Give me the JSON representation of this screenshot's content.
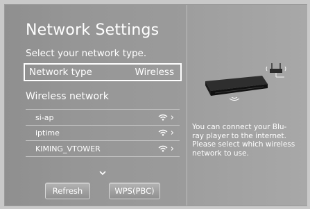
{
  "screen": {
    "title": "Network Settings",
    "subtitle": "Select your network type.",
    "network_type": {
      "label": "Network type",
      "value": "Wireless"
    },
    "wireless_title": "Wireless network",
    "networks": [
      {
        "name": "si-ap",
        "icon": "wifi-icon"
      },
      {
        "name": "iptime",
        "icon": "wifi-icon"
      },
      {
        "name": "KIMING_VTOWER",
        "icon": "wifi-icon"
      }
    ],
    "buttons": {
      "refresh": "Refresh",
      "wps": "WPS(PBC)"
    }
  },
  "info": {
    "description_lines": [
      "You can connect your Blu-",
      "ray player to the internet.",
      "Please select which wireless",
      "network to use."
    ]
  }
}
